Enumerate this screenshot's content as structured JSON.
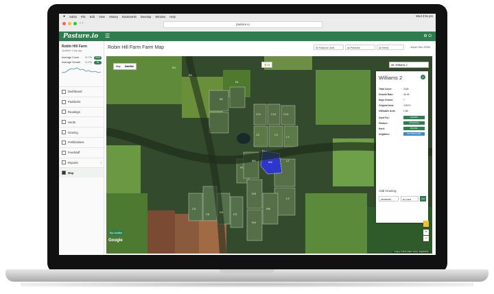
{
  "menubar": {
    "apple": "",
    "items": [
      "Safari",
      "File",
      "Edit",
      "View",
      "History",
      "Bookmarks",
      "Develop",
      "Window",
      "Help"
    ],
    "clock": "Wed 2:51 pm"
  },
  "browser": {
    "url": "pasture.io"
  },
  "app": {
    "logo": "Pasture.io",
    "menu_icon": "hamburger-icon"
  },
  "sidebar": {
    "farm_name": "Robin Hill Farm",
    "farm_sub": "Updated 1 day ago",
    "stats": [
      {
        "label": "Average Cover",
        "delta": "+5.7%",
        "value": "2100"
      },
      {
        "label": "Average Growth",
        "delta": "+1.2%",
        "value": "43"
      }
    ],
    "nav": [
      {
        "label": "Dashboard",
        "icon": "dashboard-icon"
      },
      {
        "label": "Paddocks",
        "icon": "paddocks-icon"
      },
      {
        "label": "Readings",
        "icon": "readings-icon"
      },
      {
        "label": "Herds",
        "icon": "herds-icon"
      },
      {
        "label": "Grazing",
        "icon": "grazing-icon"
      },
      {
        "label": "Fertilisations",
        "icon": "fertiliser-icon"
      },
      {
        "label": "Feedstuff",
        "icon": "feedstuff-icon"
      },
      {
        "label": "Reports",
        "icon": "reports-icon"
      },
      {
        "label": "Map",
        "icon": "map-icon"
      }
    ]
  },
  "main": {
    "title": "Robin Hill Farm Farm Map",
    "filters": [
      "All Paddock Uses",
      "All Pastures",
      "All Herds"
    ],
    "import_label": "Import Geo JSON"
  },
  "map": {
    "toggle": [
      "Map",
      "Satellite"
    ],
    "paddock_select": "All: Williams 2",
    "my_location": "My Location",
    "google": "Google",
    "attribution": "Imagery ©2016 CNES / Airbus, DigitalGlobe",
    "paddock_labels": [
      "B4",
      "B3",
      "B2",
      "B1",
      "C11",
      "C12",
      "C13",
      "C6",
      "C5",
      "C4",
      "C3",
      "C2",
      "C1",
      "L1",
      "L2",
      "L3",
      "W1",
      "W2",
      "W3",
      "W4",
      "W5",
      "P1"
    ],
    "selected_paddock": "W2"
  },
  "panel": {
    "title": "Williams 2",
    "rows": [
      {
        "label": "Total Cover:",
        "value": "2045"
      },
      {
        "label": "Growth Rate:",
        "value": "46.95"
      },
      {
        "label": "Days Grown:",
        "value": "7"
      },
      {
        "label": "Original Area:",
        "value": "3.8074"
      },
      {
        "label": "Utilisable Area:",
        "value": "2.86"
      }
    ],
    "buttons": [
      {
        "label": "Used For:",
        "value": "GRAZING",
        "color": "green"
      },
      {
        "label": "Pasture:",
        "value": "RYEGRASS",
        "color": "green"
      },
      {
        "label": "Herd:",
        "value": "MILKING",
        "color": "green"
      },
      {
        "label": "Irrigation:",
        "value": "NOT IRRIGATED",
        "color": "blue"
      }
    ],
    "add_grazing": "Add Grazing",
    "grazing_date": "24/09/2016",
    "grazing_herd": "Dry Herd",
    "grazing_add": "Add"
  }
}
